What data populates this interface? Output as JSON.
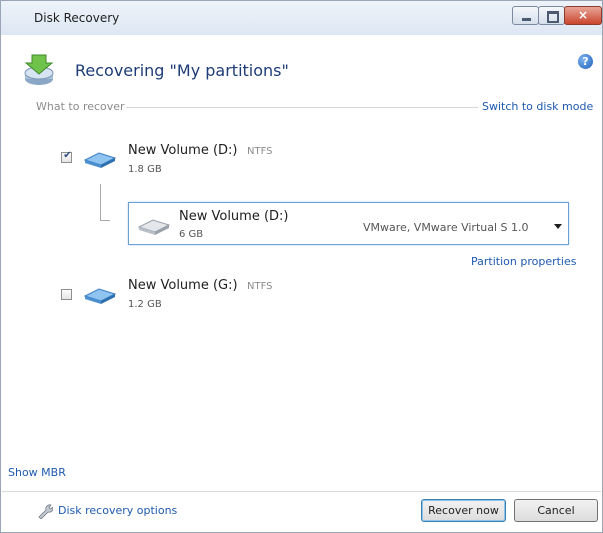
{
  "window": {
    "title": "Disk Recovery",
    "close_glyph": "×"
  },
  "header": {
    "title": "Recovering \"My partitions\"",
    "icon": "disk-recovery-icon",
    "help_glyph": "?"
  },
  "section": {
    "label": "What to recover",
    "switch_link": "Switch to disk mode"
  },
  "volumes": [
    {
      "checked": true,
      "check_glyph": "✔",
      "name": "New Volume (D:)",
      "fs": "NTFS",
      "size": "1.8 GB",
      "target": {
        "name": "New Volume (D:)",
        "size": "6 GB",
        "device": "VMware, VMware Virtual S 1.0"
      },
      "properties_link": "Partition properties"
    },
    {
      "checked": false,
      "name": "New Volume (G:)",
      "fs": "NTFS",
      "size": "1.2 GB"
    }
  ],
  "links": {
    "show_mbr": "Show MBR"
  },
  "footer": {
    "options_link": "Disk recovery options",
    "recover_button": "Recover now",
    "cancel_button": "Cancel"
  },
  "colors": {
    "link": "#1e5ab0",
    "title": "#1e3c78",
    "accent_border": "#6aa0d6"
  }
}
